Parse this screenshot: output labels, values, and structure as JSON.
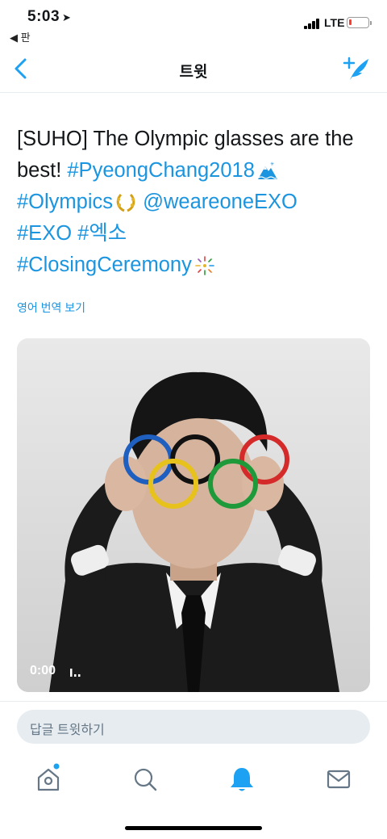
{
  "status_bar": {
    "time": "5:03",
    "back_app_label": "◀ 판",
    "network": "LTE",
    "battery_color": "#ff3b30"
  },
  "nav": {
    "title": "트윗",
    "back_icon": "chevron-left-icon",
    "compose_icon": "compose-tweet-icon",
    "accent": "#1da1f2"
  },
  "tweet": {
    "line1": "[SUHO] The Olympic glasses are the",
    "line2_text": "best! ",
    "tag_pyeongchang": "#PyeongChang2018",
    "tag_olympics": "#Olympics",
    "mention": "@weareoneEXO",
    "tag_exo": "#EXO",
    "tag_exo_kr": "#엑소",
    "tag_closing": "#ClosingCeremony",
    "translate_label": "영어 번역 보기",
    "link_color": "#1b95e0"
  },
  "video": {
    "time": "0:00",
    "ring_colors": [
      "#1f5fbf",
      "#e7c21d",
      "#111111",
      "#1f9a3b",
      "#d42a2a"
    ]
  },
  "reply": {
    "placeholder": "답글 트윗하기"
  },
  "tab_bar": {
    "items": [
      {
        "icon": "home-icon",
        "active": false,
        "notification_dot": true
      },
      {
        "icon": "search-icon",
        "active": false
      },
      {
        "icon": "bell-icon",
        "active": true
      },
      {
        "icon": "mail-icon",
        "active": false
      }
    ],
    "active_color": "#1da1f2",
    "inactive_color": "#657786"
  }
}
